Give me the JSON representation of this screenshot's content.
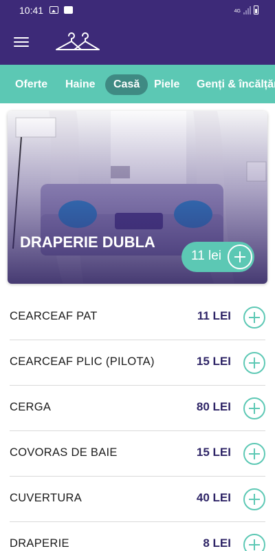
{
  "status_bar": {
    "time": "10:41",
    "network": "4G",
    "icons": [
      "gallery-icon",
      "check-icon",
      "signal-icon",
      "battery-icon"
    ]
  },
  "app_bar": {
    "logo_icon": "hanger-logo-icon",
    "menu_icon": "hamburger-menu-icon"
  },
  "tabs": [
    {
      "label": "Oferte",
      "active": false
    },
    {
      "label": "Haine",
      "active": false
    },
    {
      "label": "Casă",
      "active": true
    },
    {
      "label": "Piele",
      "active": false
    },
    {
      "label": "Genți & încălțăminte",
      "active": false
    }
  ],
  "featured": {
    "title": "DRAPERIE DUBLA",
    "price": "11 lei"
  },
  "products": [
    {
      "name": "CEARCEAF PAT",
      "price": "11 LEI"
    },
    {
      "name": "CEARCEAF PLIC (PILOTA)",
      "price": "15 LEI"
    },
    {
      "name": "CERGA",
      "price": "80 LEI"
    },
    {
      "name": "COVORAS DE BAIE",
      "price": "15 LEI"
    },
    {
      "name": "CUVERTURA",
      "price": "40 LEI"
    },
    {
      "name": "DRAPERIE",
      "price": "8 LEI"
    }
  ],
  "colors": {
    "primary": "#3d2a78",
    "accent": "#5cc8b4",
    "active_tab": "#3f8a83",
    "price_text": "#2e2466"
  }
}
